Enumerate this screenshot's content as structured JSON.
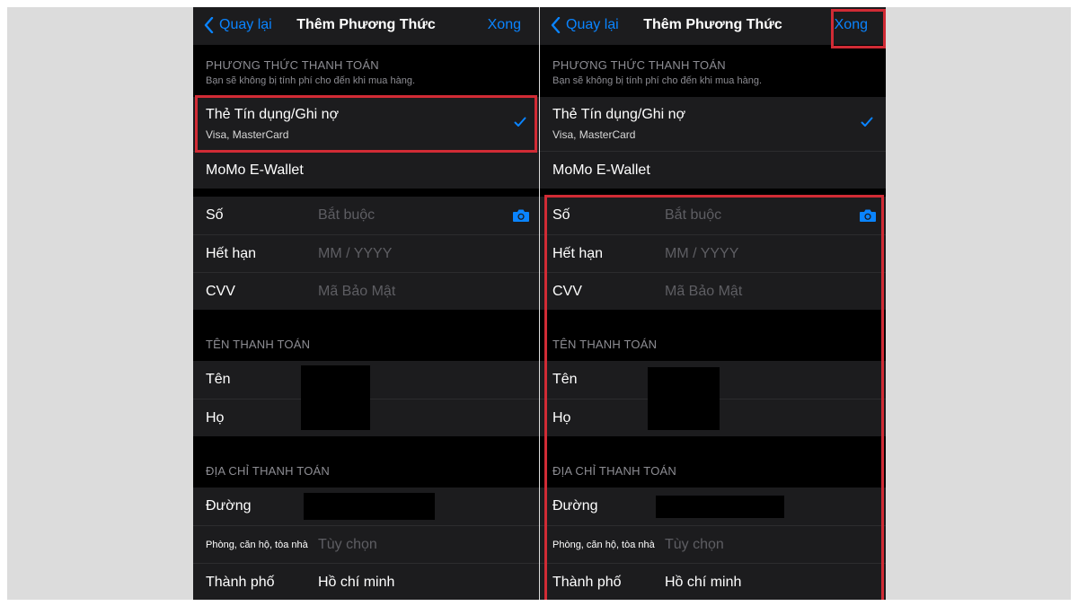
{
  "nav": {
    "back_label": "Quay lại",
    "title": "Thêm Phương Thức",
    "done_label": "Xong"
  },
  "payment_method": {
    "header": "PHƯƠNG THỨC THANH TOÁN",
    "subtitle": "Bạn sẽ không bị tính phí cho đến khi mua hàng.",
    "card_title": "Thẻ Tín dụng/Ghi nợ",
    "card_sub": "Visa, MasterCard",
    "momo": "MoMo E-Wallet"
  },
  "card_fields": {
    "number_label": "Số",
    "number_placeholder": "Bắt buộc",
    "expiry_label": "Hết hạn",
    "expiry_placeholder": "MM / YYYY",
    "cvv_label": "CVV",
    "cvv_placeholder": "Mã Bảo Mật"
  },
  "billing_name": {
    "header": "TÊN THANH TOÁN",
    "first_label": "Tên",
    "last_label": "Họ"
  },
  "billing_address": {
    "header": "ĐỊA CHỈ THANH TOÁN",
    "street_label": "Đường",
    "apt_label": "Phòng, căn hộ, tòa nhà",
    "apt_placeholder": "Tùy chọn",
    "city_label": "Thành phố",
    "city_value": "Hồ chí minh"
  },
  "colors": {
    "accent": "#0a84ff",
    "highlight": "#d12b35",
    "cell_background": "#1c1c1e"
  },
  "icons": {
    "back": "chevron-left-icon",
    "check": "checkmark-icon",
    "camera": "camera-icon"
  }
}
